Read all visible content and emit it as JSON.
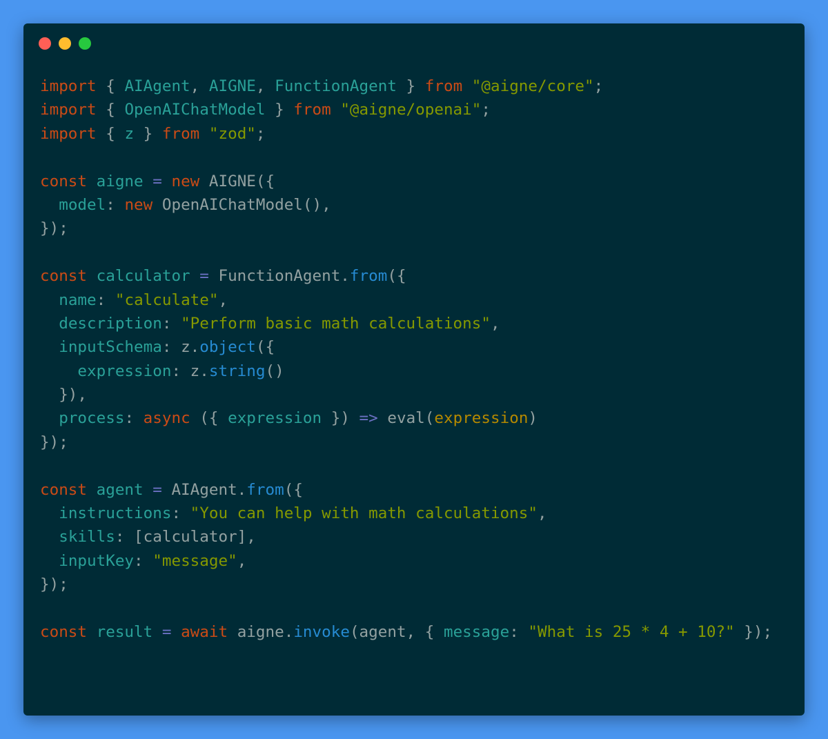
{
  "window": {
    "controls": [
      {
        "name": "close",
        "color": "#ff5f56"
      },
      {
        "name": "minimize",
        "color": "#ffbd2e"
      },
      {
        "name": "maximize",
        "color": "#27c93f"
      }
    ]
  },
  "code": {
    "lines": [
      [
        [
          "kw",
          "import"
        ],
        [
          "pl",
          " { "
        ],
        [
          "id",
          "AIAgent"
        ],
        [
          "pl",
          ", "
        ],
        [
          "id",
          "AIGNE"
        ],
        [
          "pl",
          ", "
        ],
        [
          "id",
          "FunctionAgent"
        ],
        [
          "pl",
          " } "
        ],
        [
          "kw",
          "from"
        ],
        [
          "pl",
          " "
        ],
        [
          "str",
          "\"@aigne/core\""
        ],
        [
          "pl",
          ";"
        ]
      ],
      [
        [
          "kw",
          "import"
        ],
        [
          "pl",
          " { "
        ],
        [
          "id",
          "OpenAIChatModel"
        ],
        [
          "pl",
          " } "
        ],
        [
          "kw",
          "from"
        ],
        [
          "pl",
          " "
        ],
        [
          "str",
          "\"@aigne/openai\""
        ],
        [
          "pl",
          ";"
        ]
      ],
      [
        [
          "kw",
          "import"
        ],
        [
          "pl",
          " { "
        ],
        [
          "id",
          "z"
        ],
        [
          "pl",
          " } "
        ],
        [
          "kw",
          "from"
        ],
        [
          "pl",
          " "
        ],
        [
          "str",
          "\"zod\""
        ],
        [
          "pl",
          ";"
        ]
      ],
      [],
      [
        [
          "kw",
          "const"
        ],
        [
          "pl",
          " "
        ],
        [
          "id",
          "aigne"
        ],
        [
          "pl",
          " "
        ],
        [
          "op",
          "="
        ],
        [
          "pl",
          " "
        ],
        [
          "kw",
          "new"
        ],
        [
          "pl",
          " AIGNE({"
        ]
      ],
      [
        [
          "pl",
          "  "
        ],
        [
          "id",
          "model"
        ],
        [
          "pl",
          ": "
        ],
        [
          "kw",
          "new"
        ],
        [
          "pl",
          " OpenAIChatModel(),"
        ]
      ],
      [
        [
          "pl",
          "});"
        ]
      ],
      [],
      [
        [
          "kw",
          "const"
        ],
        [
          "pl",
          " "
        ],
        [
          "id",
          "calculator"
        ],
        [
          "pl",
          " "
        ],
        [
          "op",
          "="
        ],
        [
          "pl",
          " FunctionAgent."
        ],
        [
          "fn",
          "from"
        ],
        [
          "pl",
          "({"
        ]
      ],
      [
        [
          "pl",
          "  "
        ],
        [
          "id",
          "name"
        ],
        [
          "pl",
          ": "
        ],
        [
          "str",
          "\"calculate\""
        ],
        [
          "pl",
          ","
        ]
      ],
      [
        [
          "pl",
          "  "
        ],
        [
          "id",
          "description"
        ],
        [
          "pl",
          ": "
        ],
        [
          "str",
          "\"Perform basic math calculations\""
        ],
        [
          "pl",
          ","
        ]
      ],
      [
        [
          "pl",
          "  "
        ],
        [
          "id",
          "inputSchema"
        ],
        [
          "pl",
          ": z."
        ],
        [
          "fn",
          "object"
        ],
        [
          "pl",
          "({"
        ]
      ],
      [
        [
          "pl",
          "    "
        ],
        [
          "id",
          "expression"
        ],
        [
          "pl",
          ": z."
        ],
        [
          "fn",
          "string"
        ],
        [
          "pl",
          "()"
        ]
      ],
      [
        [
          "pl",
          "  }),"
        ]
      ],
      [
        [
          "pl",
          "  "
        ],
        [
          "id",
          "process"
        ],
        [
          "pl",
          ": "
        ],
        [
          "kw",
          "async"
        ],
        [
          "pl",
          " ({ "
        ],
        [
          "id",
          "expression"
        ],
        [
          "pl",
          " }) "
        ],
        [
          "op",
          "=>"
        ],
        [
          "pl",
          " eval("
        ],
        [
          "arg",
          "expression"
        ],
        [
          "pl",
          ")"
        ]
      ],
      [
        [
          "pl",
          "});"
        ]
      ],
      [],
      [
        [
          "kw",
          "const"
        ],
        [
          "pl",
          " "
        ],
        [
          "id",
          "agent"
        ],
        [
          "pl",
          " "
        ],
        [
          "op",
          "="
        ],
        [
          "pl",
          " AIAgent."
        ],
        [
          "fn",
          "from"
        ],
        [
          "pl",
          "({"
        ]
      ],
      [
        [
          "pl",
          "  "
        ],
        [
          "id",
          "instructions"
        ],
        [
          "pl",
          ": "
        ],
        [
          "str",
          "\"You can help with math calculations\""
        ],
        [
          "pl",
          ","
        ]
      ],
      [
        [
          "pl",
          "  "
        ],
        [
          "id",
          "skills"
        ],
        [
          "pl",
          ": [calculator],"
        ]
      ],
      [
        [
          "pl",
          "  "
        ],
        [
          "id",
          "inputKey"
        ],
        [
          "pl",
          ": "
        ],
        [
          "str",
          "\"message\""
        ],
        [
          "pl",
          ","
        ]
      ],
      [
        [
          "pl",
          "});"
        ]
      ],
      [],
      [
        [
          "kw",
          "const"
        ],
        [
          "pl",
          " "
        ],
        [
          "id",
          "result"
        ],
        [
          "pl",
          " "
        ],
        [
          "op",
          "="
        ],
        [
          "pl",
          " "
        ],
        [
          "kw",
          "await"
        ],
        [
          "pl",
          " aigne."
        ],
        [
          "fn",
          "invoke"
        ],
        [
          "pl",
          "(agent, { "
        ],
        [
          "id",
          "message"
        ],
        [
          "pl",
          ": "
        ],
        [
          "str",
          "\"What is 25 * 4 + 10?\""
        ],
        [
          "pl",
          " });"
        ]
      ]
    ]
  }
}
